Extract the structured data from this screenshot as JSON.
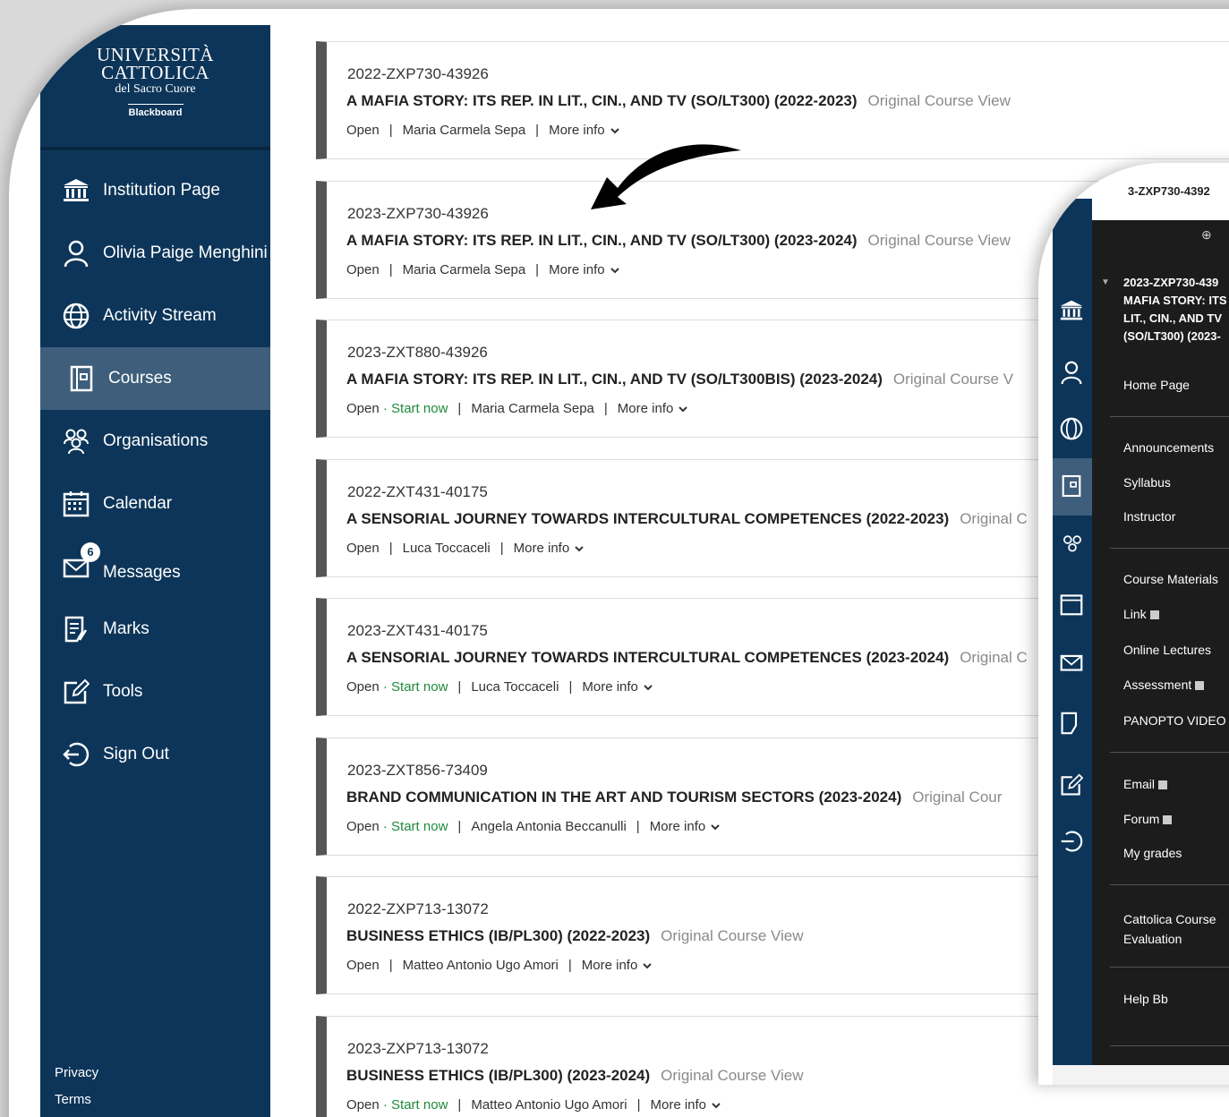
{
  "brand": {
    "line1": "UNIVERSITÀ",
    "line2": "CATTOLICA",
    "line3": "del Sacro Cuore",
    "line4": "Blackboard"
  },
  "nav": [
    {
      "label": "Institution Page",
      "icon": "bank-icon"
    },
    {
      "label": "Olivia Paige Menghini",
      "icon": "user-icon"
    },
    {
      "label": "Activity Stream",
      "icon": "globe-icon"
    },
    {
      "label": "Courses",
      "icon": "courses-icon",
      "active": true
    },
    {
      "label": "Organisations",
      "icon": "people-icon"
    },
    {
      "label": "Calendar",
      "icon": "calendar-icon"
    },
    {
      "label": "Messages",
      "icon": "envelope-icon",
      "badge": "6"
    },
    {
      "label": "Marks",
      "icon": "marks-icon"
    },
    {
      "label": "Tools",
      "icon": "tools-icon"
    },
    {
      "label": "Sign Out",
      "icon": "sign-out-icon"
    }
  ],
  "footer": {
    "privacy": "Privacy",
    "terms": "Terms"
  },
  "courses": [
    {
      "id": "2022-ZXP730-43926",
      "title": "A MAFIA STORY: ITS REP. IN LIT., CIN., AND TV (SO/LT300) (2022-2023)",
      "view": "Original Course View",
      "status": "Open",
      "start": "",
      "instructor": "Maria Carmela Sepa",
      "more": "More info"
    },
    {
      "id": "2023-ZXP730-43926",
      "title": "A MAFIA STORY: ITS REP. IN LIT., CIN., AND TV (SO/LT300) (2023-2024)",
      "view": "Original Course View",
      "status": "Open",
      "start": "",
      "instructor": "Maria Carmela Sepa",
      "more": "More info"
    },
    {
      "id": "2023-ZXT880-43926",
      "title": "A MAFIA STORY: ITS REP. IN LIT., CIN., AND TV (SO/LT300BIS) (2023-2024)",
      "view": "Original Course V",
      "status": "Open",
      "start": "Start now",
      "instructor": "Maria Carmela Sepa",
      "more": "More info"
    },
    {
      "id": "2022-ZXT431-40175",
      "title": "A SENSORIAL JOURNEY TOWARDS INTERCULTURAL COMPETENCES (2022-2023)",
      "view": "Original C",
      "status": "Open",
      "start": "",
      "instructor": "Luca Toccaceli",
      "more": "More info"
    },
    {
      "id": "2023-ZXT431-40175",
      "title": "A SENSORIAL JOURNEY TOWARDS INTERCULTURAL COMPETENCES (2023-2024)",
      "view": "Original C",
      "status": "Open",
      "start": "Start now",
      "instructor": "Luca Toccaceli",
      "more": "More info"
    },
    {
      "id": "2023-ZXT856-73409",
      "title": "BRAND COMMUNICATION IN THE ART AND TOURISM SECTORS (2023-2024)",
      "view": "Original Cour",
      "status": "Open",
      "start": "Start now",
      "instructor": "Angela Antonia Beccanulli",
      "more": "More info"
    },
    {
      "id": "2022-ZXP713-13072",
      "title": "BUSINESS ETHICS (IB/PL300) (2022-2023)",
      "view": "Original Course View",
      "status": "Open",
      "start": "",
      "instructor": "Matteo Antonio Ugo Amori",
      "more": "More info"
    },
    {
      "id": "2023-ZXP713-13072",
      "title": "BUSINESS ETHICS (IB/PL300) (2023-2024)",
      "view": "Original Course View",
      "status": "Open",
      "start": "Start now",
      "instructor": "Matteo Antonio Ugo Amori",
      "more": "More info"
    }
  ],
  "panel": {
    "top_id": "3-ZXP730-4392",
    "course_title": [
      "2023-ZXP730-439",
      "MAFIA STORY: ITS",
      "LIT., CIN., AND TV",
      "(SO/LT300) (2023-"
    ],
    "home": "Home Page",
    "group1": [
      "Announcements",
      "Syllabus",
      "Instructor"
    ],
    "group2": [
      "Course Materials",
      "Link",
      "Online Lectures",
      "Assessment",
      "PANOPTO VIDEO"
    ],
    "group3": [
      "Email",
      "Forum",
      "My grades"
    ],
    "group4": [
      "Cattolica Course",
      "Evaluation"
    ],
    "help": "Help Bb"
  },
  "colors": {
    "sidebar": "#0d3559",
    "active": "#3e5e7b",
    "start": "#1e8a3a",
    "menu": "#1c1c1c"
  }
}
